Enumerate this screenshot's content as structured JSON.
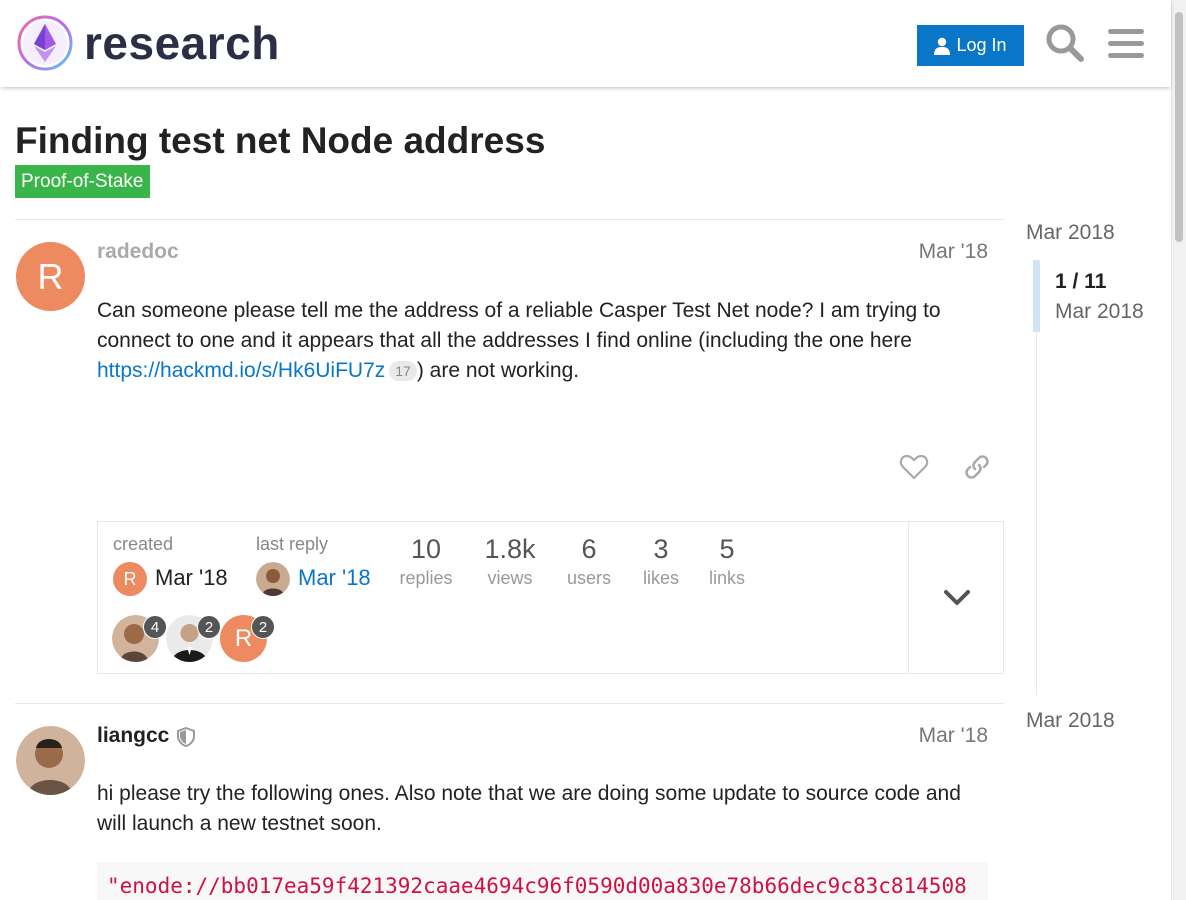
{
  "header": {
    "logo_text": "research",
    "login_label": "Log In"
  },
  "topic": {
    "title": "Finding test net Node address",
    "category": "Proof-of-Stake",
    "category_color": "#3ab54a"
  },
  "posts": [
    {
      "username": "radedoc",
      "avatar_letter": "R",
      "date": "Mar '18",
      "body_text": "Can someone please tell me the address of a reliable Casper Test Net node? I am trying to connect to one and it appears that all the addresses I find online (including the one here ",
      "link_text": "https://hackmd.io/s/Hk6UiFU7z",
      "link_clicks": "17",
      "body_suffix": ") are not working."
    },
    {
      "username": "liangcc",
      "date": "Mar '18",
      "body_text": "hi please try the following ones. Also note that we are doing some update to source code and will launch a new testnet soon.",
      "code": "\"enode://bb017ea59f421392caae4694c96f0590d00a830e78b66dec9c83c814508"
    }
  ],
  "topic_map": {
    "created_label": "created",
    "created_date": "Mar '18",
    "last_reply_label": "last reply",
    "last_reply_date": "Mar '18",
    "stats": [
      {
        "value": "10",
        "label": "replies"
      },
      {
        "value": "1.8k",
        "label": "views"
      },
      {
        "value": "6",
        "label": "users"
      },
      {
        "value": "3",
        "label": "likes"
      },
      {
        "value": "5",
        "label": "links"
      }
    ],
    "participants": [
      {
        "count": "4"
      },
      {
        "count": "2"
      },
      {
        "count": "2",
        "letter": "R"
      }
    ]
  },
  "timeline": {
    "top_date": "Mar 2018",
    "position": "1 / 11",
    "position_date": "Mar 2018",
    "bottom_date": "Mar 2018"
  },
  "colors": {
    "accent": "#0a76c8",
    "avatar_orange": "#ee8a5f"
  }
}
